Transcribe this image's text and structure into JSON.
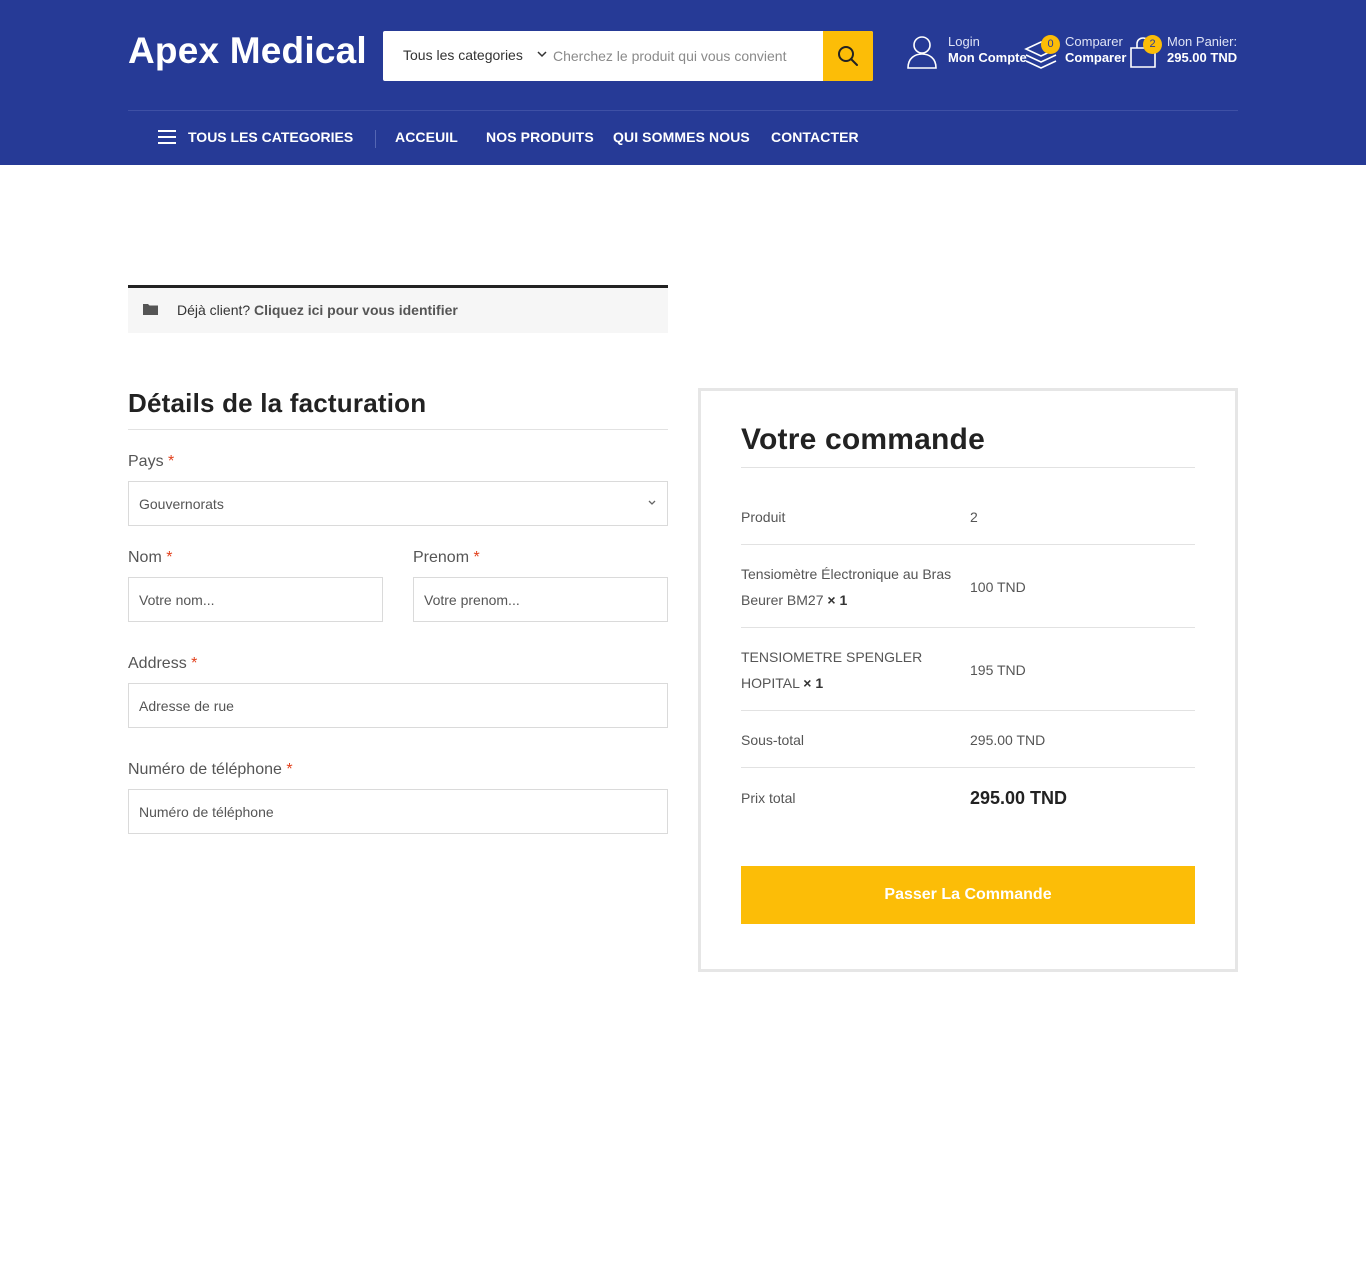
{
  "header": {
    "logo": "Apex Medical",
    "search": {
      "category": "Tous les categories",
      "placeholder": "Cherchez le produit qui vous convient"
    },
    "account": {
      "small": "Login",
      "big": "Mon Compte"
    },
    "compare": {
      "small": "Comparer",
      "big": "Comparer",
      "count": "0"
    },
    "cart": {
      "small": "Mon Panier:",
      "big": "295.00 TND",
      "count": "2"
    },
    "accent_color": "#fcbd07",
    "brand_color": "#263a96"
  },
  "nav": {
    "all_categories": "TOUS LES CATEGORIES",
    "items": [
      "ACCEUIL",
      "NOS PRODUITS",
      "QUI SOMMES NOUS",
      "CONTACTER"
    ]
  },
  "notice": {
    "text": "Déjà client?",
    "link": "Cliquez ici pour vous identifier"
  },
  "billing": {
    "title": "Détails de la facturation",
    "required_mark": "*",
    "country": {
      "label": "Pays",
      "value": "Gouvernorats"
    },
    "nom": {
      "label": "Nom",
      "placeholder": "Votre nom..."
    },
    "prenom": {
      "label": "Prenom",
      "placeholder": "Votre prenom..."
    },
    "address": {
      "label": "Address",
      "placeholder": "Adresse de rue"
    },
    "phone": {
      "label": "Numéro de téléphone",
      "placeholder": "Numéro de téléphone"
    }
  },
  "order": {
    "title": "Votre commande",
    "header": {
      "label": "Produit",
      "value": "2"
    },
    "items": [
      {
        "name": "Tensiomètre Électronique au Bras Beurer BM27",
        "qty": "× 1",
        "price": "100 TND"
      },
      {
        "name": "TENSIOMETRE SPENGLER HOPITAL",
        "qty": "× 1",
        "price": "195 TND"
      }
    ],
    "subtotal": {
      "label": "Sous-total",
      "value": "295.00 TND"
    },
    "total": {
      "label": "Prix total",
      "value": "295.00 TND"
    },
    "place_order": "Passer La Commande"
  }
}
